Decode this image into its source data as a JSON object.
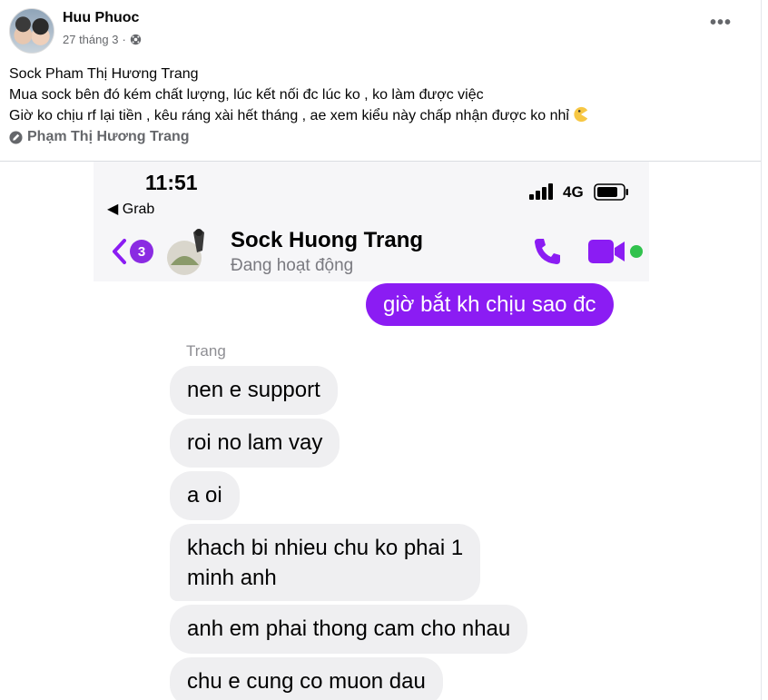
{
  "post": {
    "author": "Huu Phuoc",
    "date": "27 tháng 3",
    "separator": "·",
    "privacy_icon": "globe-icon",
    "more_label": "•••",
    "lines": [
      "Sock Pham Thị Hương Trang",
      "Mua sock bên đó kém chất lượng, lúc kết nối đc lúc ko , ko làm được việc",
      "Giờ ko chịu rf lại tiền , kêu ráng xài hết tháng , ae xem kiểu này chấp nhận được ko nhỉ"
    ],
    "emoji_icon": "pacman-face-icon",
    "tag": "Phạm Thị Hương Trang"
  },
  "phone": {
    "time": "11:51",
    "back_app": "◀ Grab",
    "network": "4G",
    "unread_count": "3",
    "contact_name": "Sock Huong Trang",
    "contact_status": "Đang hoạt động",
    "colors": {
      "accent": "#8b1cf3",
      "online": "#31c24d",
      "bubble_in": "#efeff1"
    }
  },
  "messages": {
    "outgoing": "giờ bắt kh chịu sao đc",
    "sender": "Trang",
    "incoming": [
      "nen e support",
      "roi no lam vay",
      "a oi",
      "khach bi nhieu chu ko phai 1",
      "minh anh",
      "anh em phai thong cam cho nhau",
      "chu e cung co muon dau"
    ]
  }
}
